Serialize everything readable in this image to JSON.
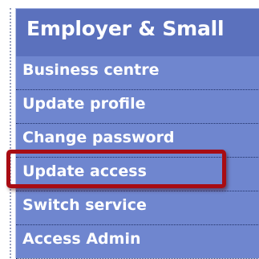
{
  "sidebar": {
    "header": "Employer & Small",
    "items": [
      {
        "label": "Business centre"
      },
      {
        "label": "Update profile"
      },
      {
        "label": "Change password"
      },
      {
        "label": "Update access"
      },
      {
        "label": "Switch service"
      },
      {
        "label": "Access Admin"
      }
    ],
    "highlighted_item": "Update access"
  },
  "colors": {
    "menu_background": "#6f86cf",
    "header_background": "#5b71bd",
    "text": "#ffffff",
    "highlight_border": "#a80c13"
  }
}
